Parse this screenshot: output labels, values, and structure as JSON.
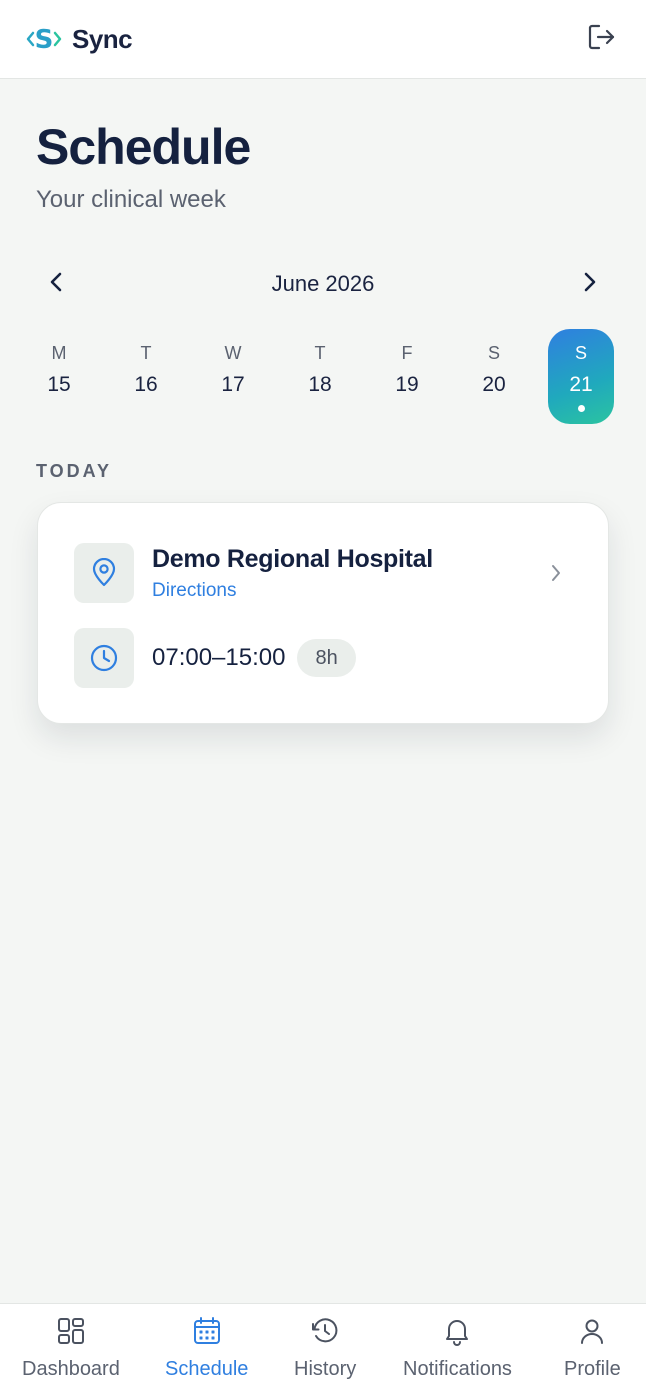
{
  "app": {
    "brand_name": "Sync",
    "logo_letter": "S"
  },
  "page": {
    "title": "Schedule",
    "subtitle": "Your clinical week"
  },
  "calendar": {
    "month_label": "June 2026",
    "days": [
      {
        "letter": "M",
        "number": "15",
        "selected": false
      },
      {
        "letter": "T",
        "number": "16",
        "selected": false
      },
      {
        "letter": "W",
        "number": "17",
        "selected": false
      },
      {
        "letter": "T",
        "number": "18",
        "selected": false
      },
      {
        "letter": "F",
        "number": "19",
        "selected": false
      },
      {
        "letter": "S",
        "number": "20",
        "selected": false
      },
      {
        "letter": "S",
        "number": "21",
        "selected": true,
        "has_event": true
      }
    ]
  },
  "today": {
    "section_label": "TODAY",
    "shift": {
      "location": "Demo Regional Hospital",
      "directions_label": "Directions",
      "time_range": "07:00–15:00",
      "duration": "8h"
    }
  },
  "bottom_nav": {
    "items": [
      {
        "label": "Dashboard",
        "icon": "dashboard-icon",
        "active": false
      },
      {
        "label": "Schedule",
        "icon": "calendar-icon",
        "active": true
      },
      {
        "label": "History",
        "icon": "history-icon",
        "active": false
      },
      {
        "label": "Notifications",
        "icon": "bell-icon",
        "active": false
      },
      {
        "label": "Profile",
        "icon": "user-icon",
        "active": false
      }
    ]
  },
  "colors": {
    "accent": "#2f7fe0",
    "accent_teal": "#2bc4a0",
    "text_dark": "#15213f",
    "text_muted": "#5b6270",
    "background": "#f4f6f4"
  }
}
